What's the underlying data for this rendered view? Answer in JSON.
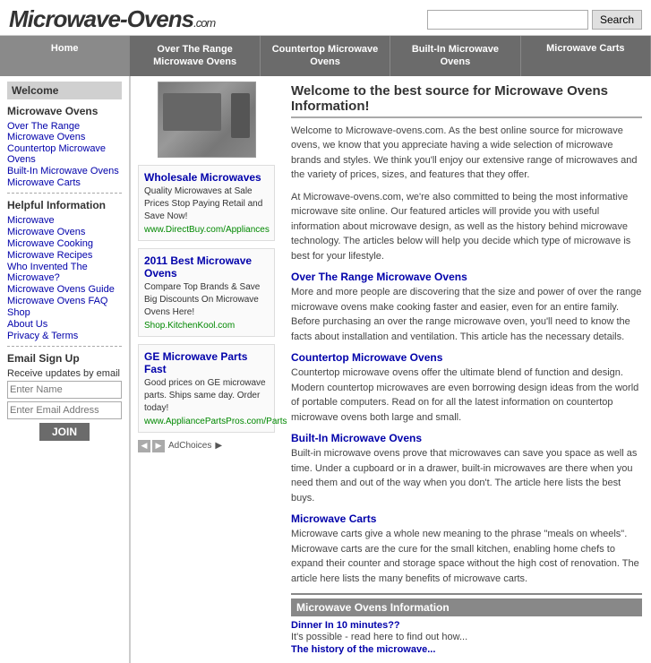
{
  "header": {
    "logo": "Microwave-Ovens",
    "logo_com": ".com",
    "search_placeholder": "",
    "search_button": "Search"
  },
  "nav": {
    "items": [
      {
        "label": "Home",
        "active": true
      },
      {
        "label": "Over The Range\nMicrowave Ovens",
        "active": false
      },
      {
        "label": "Countertop Microwave\nOvens",
        "active": false
      },
      {
        "label": "Built-In Microwave\nOvens",
        "active": false
      },
      {
        "label": "Microwave Carts",
        "active": false
      }
    ]
  },
  "sidebar": {
    "welcome_label": "Welcome",
    "microwave_ovens_title": "Microwave Ovens",
    "microwave_ovens_links": [
      "Over The Range Microwave Ovens",
      "Countertop Microwave Ovens",
      "Built-In Microwave Ovens",
      "Microwave Carts"
    ],
    "helpful_title": "Helpful Information",
    "helpful_links": [
      "Microwave",
      "Microwave Ovens",
      "Microwave Cooking",
      "Microwave Recipes",
      "Who Invented The Microwave?",
      "Microwave Ovens Guide",
      "Microwave Ovens FAQ",
      "Shop",
      "About Us",
      "Privacy & Terms"
    ],
    "email_signup_title": "Email Sign Up",
    "email_signup_desc": "Receive updates by email",
    "name_placeholder": "Enter Name",
    "email_placeholder": "Enter Email Address",
    "join_button": "JOIN"
  },
  "content": {
    "heading": "Welcome to the best source for Microwave Ovens Information!",
    "intro_para1": "Welcome to Microwave-ovens.com. As the best online source for microwave ovens, we know that you appreciate having a wide selection of microwave brands and styles. We think you'll enjoy our extensive range of microwaves and the variety of prices, sizes, and features that they offer.",
    "intro_para2": "At Microwave-ovens.com, we're also committed to being the most informative microwave site online. Our featured articles will provide you with useful information about microwave design, as well as the history behind microwave technology. The articles below will help you decide which type of microwave is best for your lifestyle.",
    "sections": [
      {
        "link": "Over The Range Microwave Ovens",
        "text": "More and more people are discovering that the size and power of over the range microwave ovens make cooking faster and easier, even for an entire family. Before purchasing an over the range microwave oven, you'll need to know the facts about installation and ventilation. This article has the necessary details."
      },
      {
        "link": "Countertop Microwave Ovens",
        "text": "Countertop microwave ovens offer the ultimate blend of function and design. Modern countertop microwaves are even borrowing design ideas from the world of portable computers. Read on for all the latest information on countertop microwave ovens both large and small."
      },
      {
        "link": "Built-In Microwave Ovens",
        "text": "Built-in microwave ovens prove that microwaves can save you space as well as time. Under a cupboard or in a drawer, built-in microwaves are there when you need them and out of the way when you don't. The article here lists the best buys."
      },
      {
        "link": "Microwave Carts",
        "text": "Microwave carts give a whole new meaning to the phrase \"meals on wheels\". Microwave carts are the cure for the small kitchen, enabling home chefs to expand their counter and storage space without the high cost of renovation. The article here lists the many benefits of microwave carts."
      }
    ],
    "bottom_section_title": "Microwave Ovens Information",
    "bottom_links": [
      {
        "link": "Dinner In 10 minutes??",
        "text": "It's possible - read here to find out how..."
      },
      {
        "link": "The history of the microwave...",
        "text": ""
      }
    ]
  },
  "ads": {
    "items": [
      {
        "title": "Wholesale Microwaves",
        "desc": "Quality Microwaves at Sale Prices Stop Paying Retail and Save Now!",
        "url": "www.DirectBuy.com/Appliances"
      },
      {
        "title": "2011 Best Microwave Ovens",
        "desc": "Compare Top Brands & Save Big Discounts On Microwave Ovens Here!",
        "url": "Shop.KitchenKool.com"
      },
      {
        "title": "GE Microwave Parts Fast",
        "desc": "Good prices on GE microwave parts. Ships same day. Order today!",
        "url": "www.AppliancePartsPros.com/Parts"
      }
    ],
    "ad_choices": "AdChoices"
  }
}
